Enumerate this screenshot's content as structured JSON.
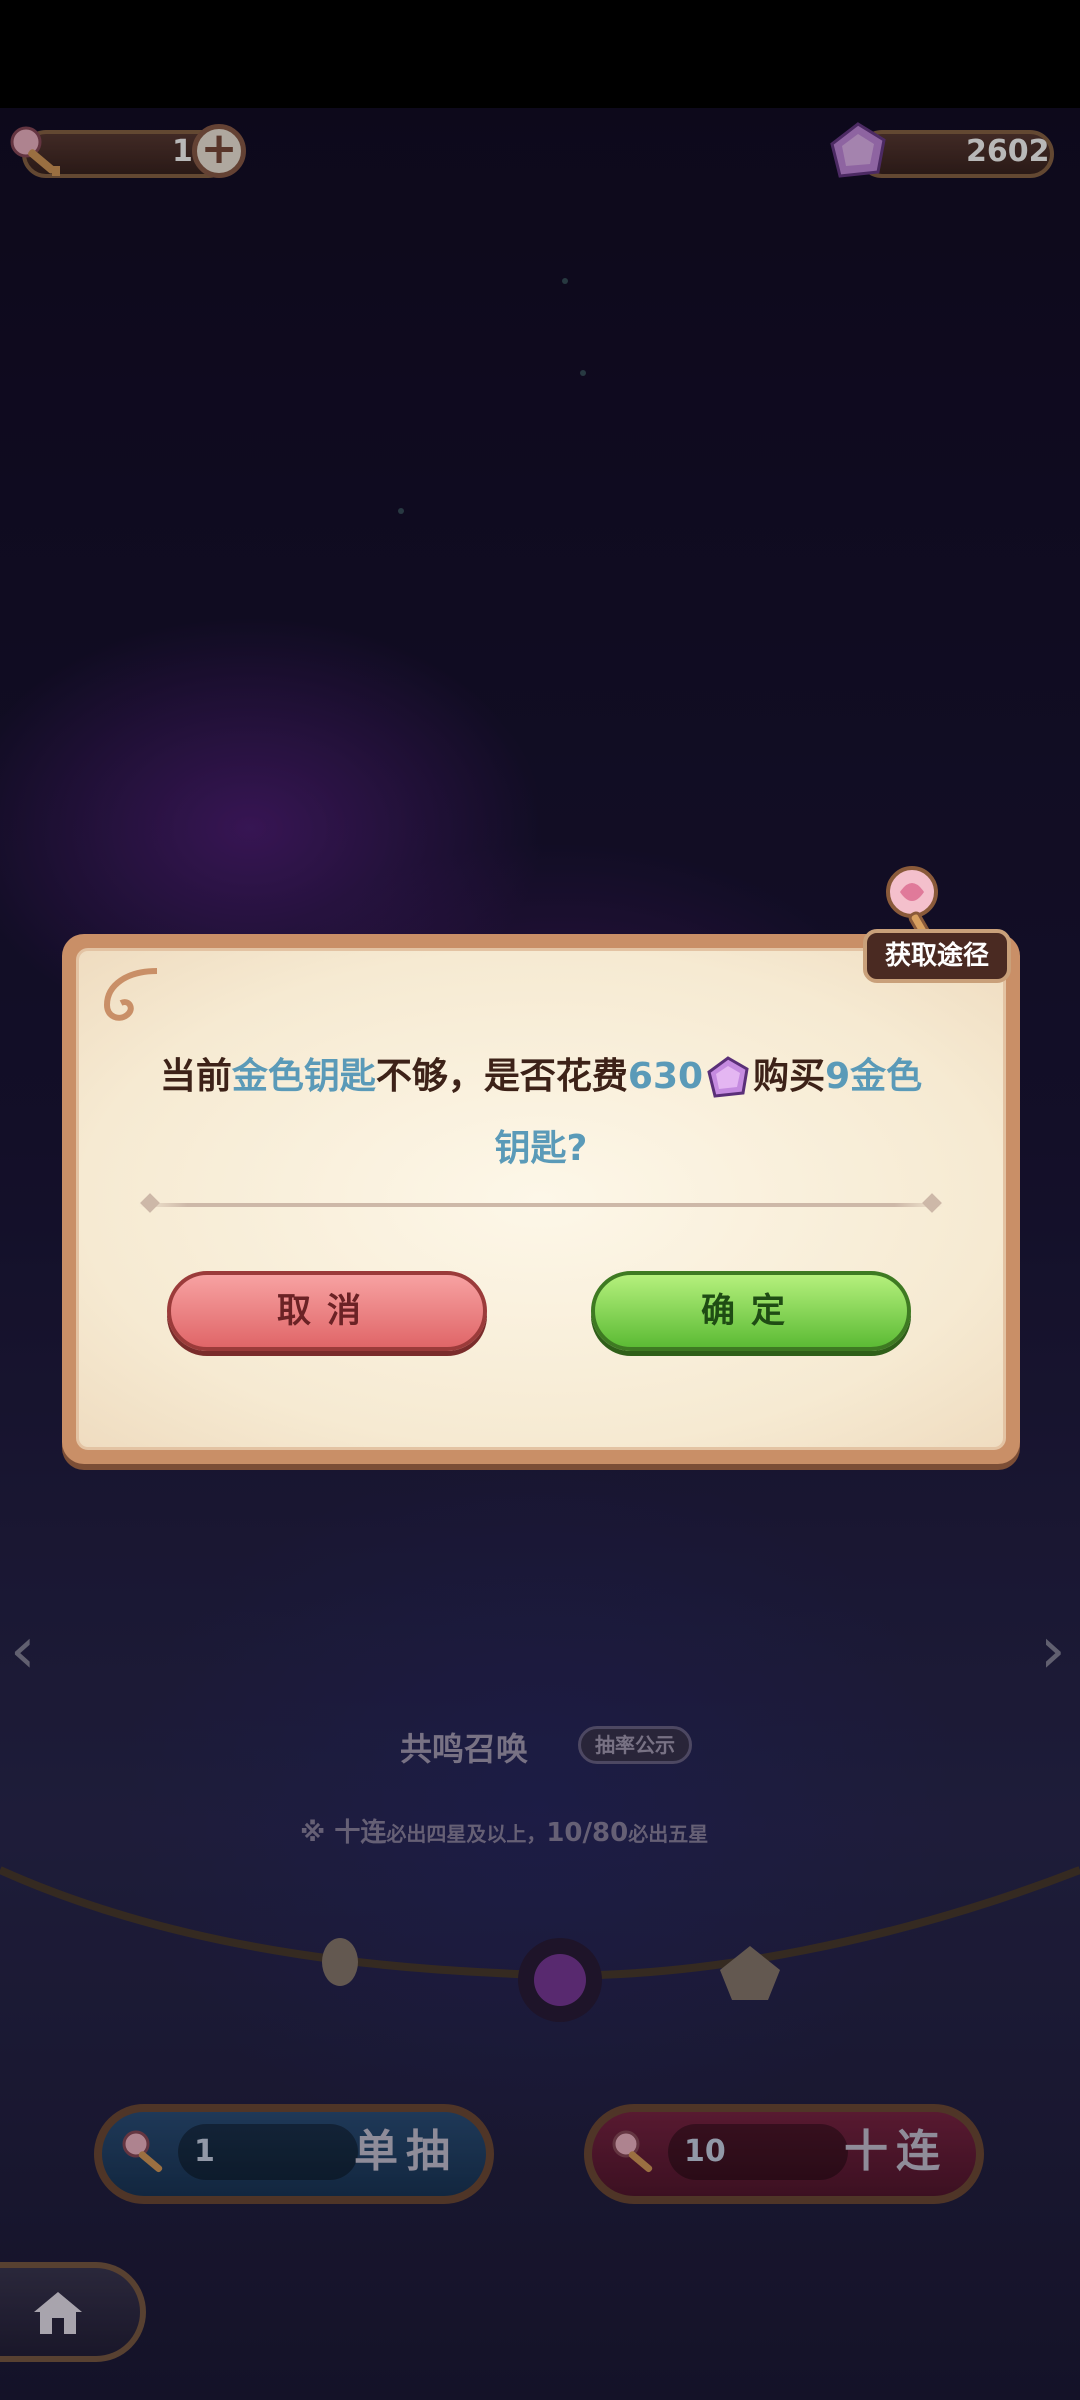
{
  "resources": {
    "keys": "1",
    "gems": "2602"
  },
  "dialog": {
    "acquire_label": "获取途径",
    "msg_part1": "当前",
    "msg_key": "金色钥匙",
    "msg_part2": "不够，是否花费",
    "msg_cost": "630",
    "msg_part3": "购买",
    "msg_amount_key": "9金色",
    "msg_key2": "钥匙?",
    "cancel_label": "取消",
    "confirm_label": "确定"
  },
  "summon": {
    "title": "共鸣召唤",
    "rate_label": "抽率公示",
    "note_prefix": "※ 十连",
    "note_mid": "必出四星及以上，",
    "note_count": "10/80",
    "note_suffix": "必出五星",
    "single_count": "1",
    "single_label": "单抽",
    "ten_count": "10",
    "ten_label": "十连"
  },
  "colors": {
    "highlight": "#5a9ab8",
    "cancel": "#e06668",
    "confirm": "#5cbb35"
  }
}
